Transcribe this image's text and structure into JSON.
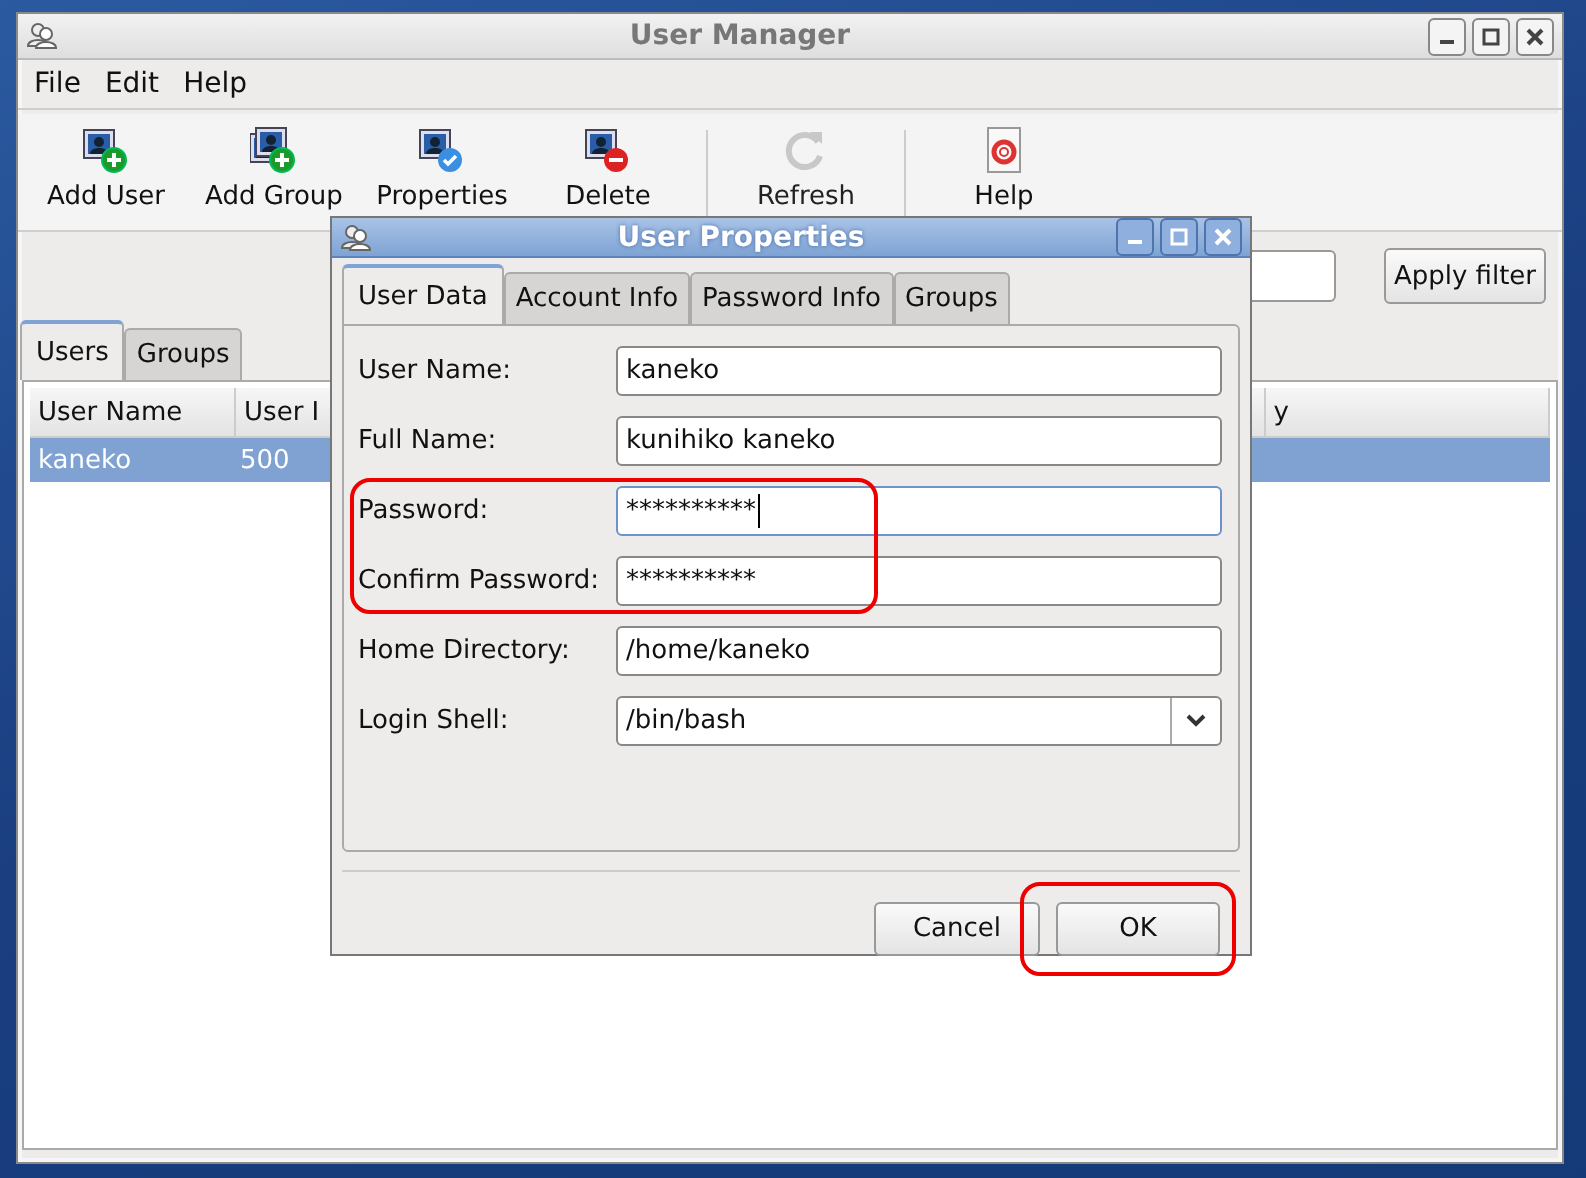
{
  "main_window": {
    "title": "User Manager",
    "menu": [
      "File",
      "Edit",
      "Help"
    ],
    "toolbar": [
      {
        "label": "Add User",
        "kind": "add_user",
        "disabled": false,
        "separated": false
      },
      {
        "label": "Add Group",
        "kind": "add_group",
        "disabled": false,
        "separated": false
      },
      {
        "label": "Properties",
        "kind": "properties",
        "disabled": false,
        "separated": false
      },
      {
        "label": "Delete",
        "kind": "delete",
        "disabled": false,
        "separated": false
      },
      {
        "label": "Refresh",
        "kind": "refresh",
        "disabled": true,
        "separated": true
      },
      {
        "label": "Help",
        "kind": "help",
        "disabled": false,
        "separated": true
      }
    ],
    "filter_button": "Apply filter",
    "tabs": [
      {
        "label": "Users",
        "selected": true
      },
      {
        "label": "Groups",
        "selected": false
      }
    ],
    "table": {
      "columns": [
        "User Name",
        "User I",
        "y"
      ],
      "rows": [
        {
          "cells": [
            "kaneko",
            "500"
          ],
          "selected": true
        }
      ]
    }
  },
  "dialog": {
    "title": "User Properties",
    "tabs": [
      {
        "label": "User Data",
        "selected": true
      },
      {
        "label": "Account Info",
        "selected": false
      },
      {
        "label": "Password Info",
        "selected": false
      },
      {
        "label": "Groups",
        "selected": false
      }
    ],
    "fields": [
      {
        "label": "User Name:",
        "value": "kaneko",
        "kind": "text",
        "focused": false,
        "highlighted": false
      },
      {
        "label": "Full Name:",
        "value": "kunihiko kaneko",
        "kind": "text",
        "focused": false,
        "highlighted": false
      },
      {
        "label": "Password:",
        "value": "**********",
        "kind": "text",
        "focused": true,
        "highlighted": true
      },
      {
        "label": "Confirm Password:",
        "value": "**********",
        "kind": "text",
        "focused": false,
        "highlighted": true
      },
      {
        "label": "Home Directory:",
        "value": "/home/kaneko",
        "kind": "text",
        "focused": false,
        "highlighted": false
      },
      {
        "label": "Login Shell:",
        "value": "/bin/bash",
        "kind": "combo",
        "focused": false,
        "highlighted": false
      }
    ],
    "buttons": [
      {
        "label": "Cancel",
        "highlighted": false
      },
      {
        "label": "OK",
        "highlighted": true
      }
    ]
  }
}
